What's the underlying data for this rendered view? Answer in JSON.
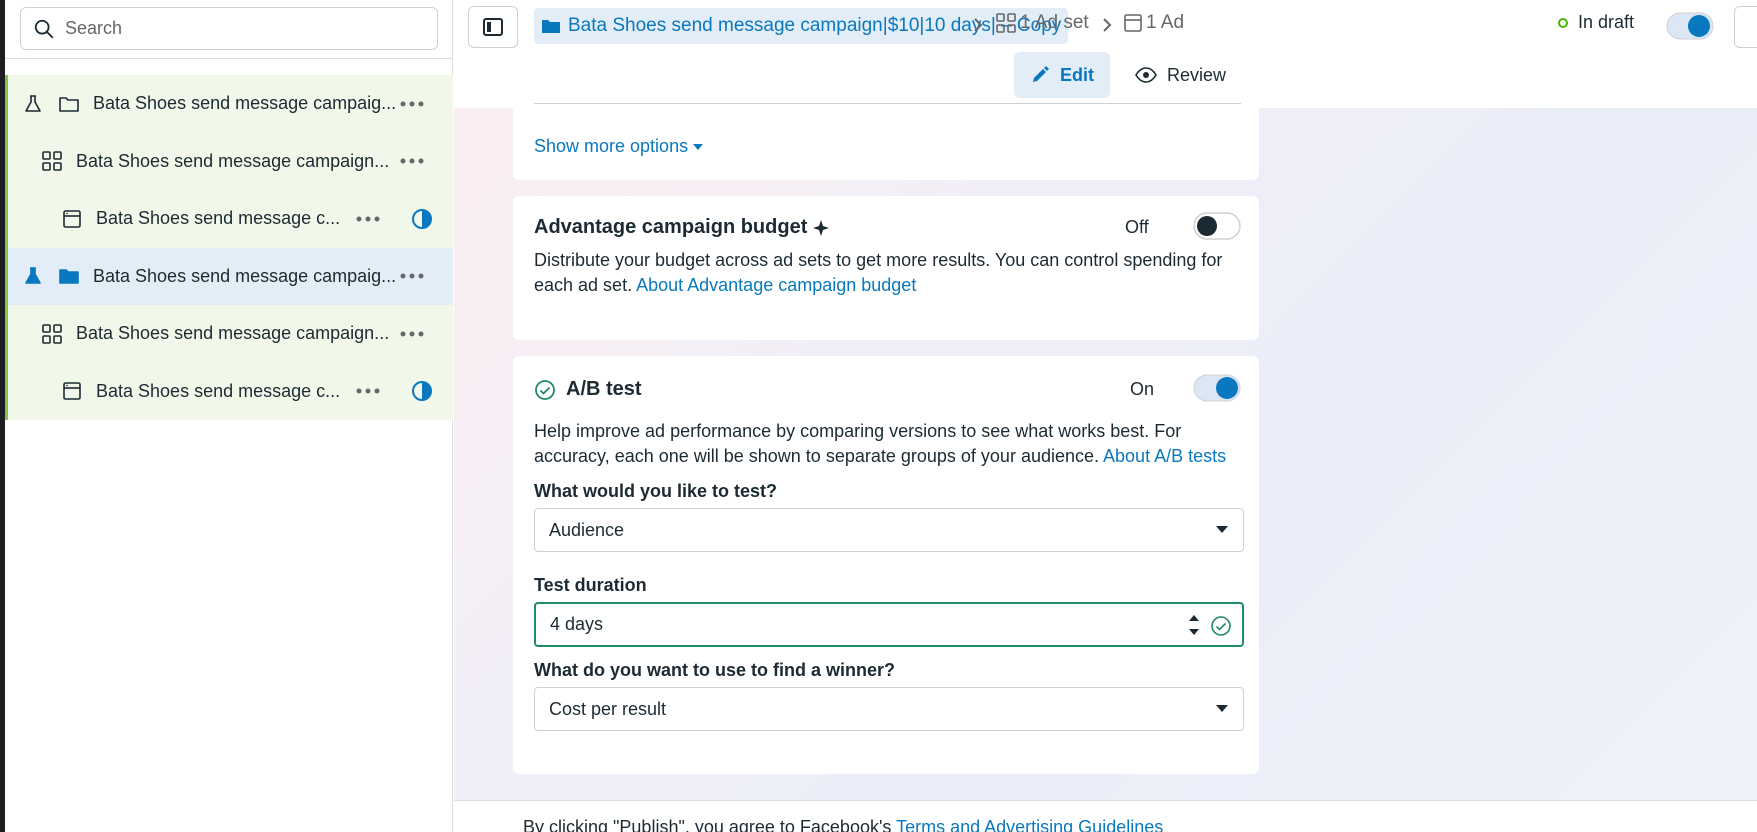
{
  "sidebar": {
    "search_placeholder": "Search",
    "items": [
      {
        "label": "Bata Shoes send message campaig...",
        "type": "campaign"
      },
      {
        "label": "Bata Shoes send message campaign...",
        "type": "adset"
      },
      {
        "label": "Bata Shoes send message c...",
        "type": "ad"
      },
      {
        "label": "Bata Shoes send message campaig...",
        "type": "campaign",
        "selected": true
      },
      {
        "label": "Bata Shoes send message campaign...",
        "type": "adset"
      },
      {
        "label": "Bata Shoes send message c...",
        "type": "ad"
      }
    ]
  },
  "topbar": {
    "campaign_crumb": "Bata Shoes send message campaign|$10|10 days| – Copy",
    "adset_crumb": "1 Ad set",
    "ad_crumb": "1 Ad",
    "status": "In draft",
    "edit_label": "Edit",
    "review_label": "Review"
  },
  "main": {
    "show_more": "Show more options",
    "budget": {
      "title": "Advantage campaign budget",
      "toggle_label": "Off",
      "desc": "Distribute your budget across ad sets to get more results. You can control spending for each ad set.",
      "link": "About Advantage campaign budget"
    },
    "abtest": {
      "title": "A/B test",
      "toggle_label": "On",
      "desc": "Help improve ad performance by comparing versions to see what works best. For accuracy, each one will be shown to separate groups of your audience.",
      "link": "About A/B tests",
      "test_label": "What would you like to test?",
      "test_value": "Audience",
      "duration_label": "Test duration",
      "duration_value": "4 days",
      "winner_label": "What do you want to use to find a winner?",
      "winner_value": "Cost per result"
    }
  },
  "footer": {
    "text": "By clicking \"Publish\", you agree to Facebook's",
    "link": "Terms and Advertising Guidelines"
  },
  "colors": {
    "accent": "#0a78be",
    "draft": "#44b700",
    "success": "#1e8a6e",
    "row_bg": "#f1f8e9",
    "row_selected": "#e3edf7"
  }
}
